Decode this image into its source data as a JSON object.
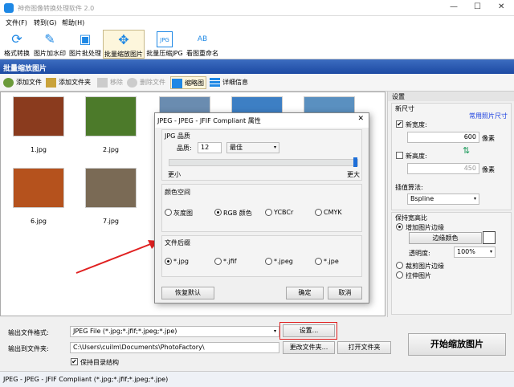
{
  "app": {
    "title": "神奇图像转换处理软件 2.0"
  },
  "menu": [
    "文件(F)",
    "转到(G)",
    "帮助(H)"
  ],
  "toolbar": [
    {
      "label": "格式转换",
      "icon": "⟳"
    },
    {
      "label": "图片加水印",
      "icon": "✎"
    },
    {
      "label": "图片批处理",
      "icon": "▣"
    },
    {
      "label": "批量缩放图片",
      "icon": "✥"
    },
    {
      "label": "批量压缩JPG",
      "icon": "JPG"
    },
    {
      "label": "看图重命名",
      "icon": "AB"
    }
  ],
  "section_title": "批量缩放图片",
  "subtoolbar": {
    "add_file": "添加文件",
    "add_folder": "添加文件夹",
    "remove": "移除",
    "delete_file": "删除文件",
    "thumbnail": "缩略图",
    "details": "详细信息"
  },
  "thumbnails": [
    {
      "name": "1.jpg",
      "color": "#8a3b1e"
    },
    {
      "name": "2.jpg",
      "color": "#4c7a2a"
    },
    {
      "name": "",
      "color": "#6a8cb0"
    },
    {
      "name": "",
      "color": "#3d7fc4"
    },
    {
      "name": "",
      "color": "#5a90c0"
    },
    {
      "name": "6.jpg",
      "color": "#b5521d"
    },
    {
      "name": "7.jpg",
      "color": "#7a6a55"
    }
  ],
  "settings": {
    "title": "设置",
    "new_size": "新尺寸",
    "common_sizes": "常用照片尺寸",
    "new_width_label": "新宽度:",
    "width": "600",
    "unit": "像素",
    "new_height_label": "新高度:",
    "height": "450",
    "interp_label": "插值算法:",
    "interp": "Bspline",
    "keep_ratio": "保持宽高比",
    "add_border": "增加图片边缘",
    "border_color": "边缘颜色",
    "opacity_label": "透明度:",
    "opacity": "100%",
    "crop_border": "裁剪图片边缘",
    "stretch": "拉伸图片"
  },
  "output": {
    "format_label": "输出文件格式:",
    "format": "JPEG File (*.jpg;*.jfif;*.jpeg;*.jpe)",
    "settings_btn": "设置...",
    "folder_label": "输出到文件夹:",
    "folder": "C:\\Users\\cuilm\\Documents\\PhotoFactory\\",
    "change_folder": "更改文件夹...",
    "open_folder": "打开文件夹",
    "keep_structure": "保持目录结构",
    "start": "开始缩放图片"
  },
  "status": "JPEG - JPEG - JFIF Compliant (*.jpg;*.jfif;*.jpeg;*.jpe)",
  "dialog": {
    "title": "JPEG - JPEG - JFIF Compliant 属性",
    "quality_group": "JPG 品质",
    "quality_label": "品质:",
    "quality": "12",
    "quality_preset": "最佳",
    "quality_fraction": 1.0,
    "smaller": "更小",
    "larger": "更大",
    "color_group": "颜色空间",
    "colors": [
      "灰度图",
      "RGB 颜色",
      "YCBCr",
      "CMYK"
    ],
    "ext_group": "文件后缀",
    "exts": [
      "*.jpg",
      "*.jfif",
      "*.jpeg",
      "*.jpe"
    ],
    "reset": "恢复默认",
    "ok": "确定",
    "cancel": "取消"
  },
  "colors": {
    "accent": "#1e88e5",
    "highlight": "#e02020"
  }
}
